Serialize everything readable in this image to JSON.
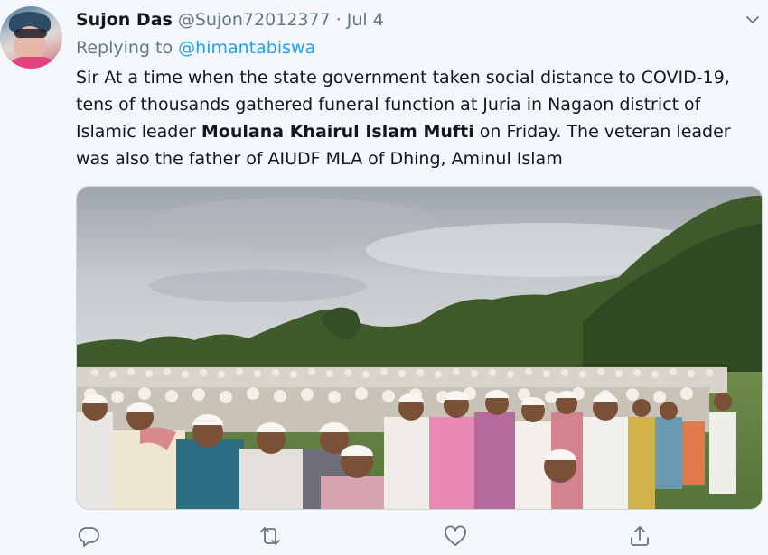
{
  "tweet": {
    "display_name": "Sujon Das",
    "handle": "@Sujon72012377",
    "separator": "·",
    "date": "Jul 4",
    "replying_prefix": "Replying to",
    "replying_to": "@himantabiswa",
    "text_part1": "Sir At a time when the state government taken social distance to COVID-19, tens of thousands gathered funeral function at Juria in Nagaon district of Islamic leader ",
    "text_bold": "Moulana Khairul Islam Mufti",
    "text_part2": " on Friday. The veteran leader was also the father of AIUDF MLA of Dhing, Aminul Islam"
  },
  "icons": {
    "reply": "reply-icon",
    "retweet": "retweet-icon",
    "like": "like-icon",
    "share": "share-icon",
    "more": "chevron-down-icon"
  },
  "colors": {
    "background": "#f5f8fa",
    "text": "#14171a",
    "secondary": "#657786",
    "link": "#1da1f2"
  }
}
